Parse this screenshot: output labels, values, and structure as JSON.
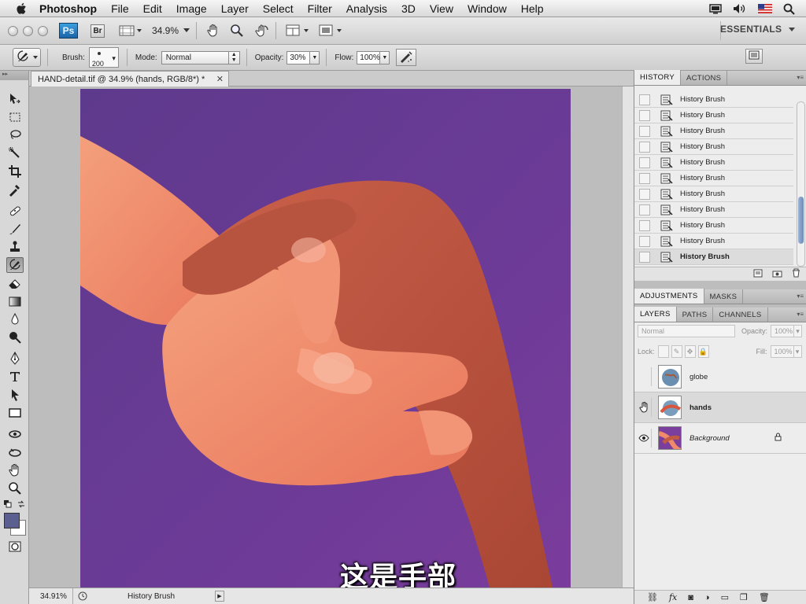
{
  "menubar": {
    "app_name": "Photoshop",
    "items": [
      "File",
      "Edit",
      "Image",
      "Layer",
      "Select",
      "Filter",
      "Analysis",
      "3D",
      "View",
      "Window",
      "Help"
    ]
  },
  "appbar": {
    "ps_label": "Ps",
    "br_label": "Br",
    "zoom": "34.9%",
    "workspace": "ESSENTIALS"
  },
  "options": {
    "brush_label": "Brush:",
    "brush_size": "200",
    "mode_label": "Mode:",
    "mode_value": "Normal",
    "opacity_label": "Opacity:",
    "opacity_value": "30%",
    "flow_label": "Flow:",
    "flow_value": "100%"
  },
  "document": {
    "tab_title": "HAND-detail.tif @ 34.9% (hands, RGB/8*) *",
    "subtitle": "这是手部",
    "status_zoom": "34.91%",
    "status_info": "History Brush"
  },
  "history_panel": {
    "tabs": [
      "HISTORY",
      "ACTIONS"
    ],
    "items": [
      "History Brush",
      "History Brush",
      "History Brush",
      "History Brush",
      "History Brush",
      "History Brush",
      "History Brush",
      "History Brush",
      "History Brush",
      "History Brush",
      "History Brush"
    ],
    "current_index": 10
  },
  "adjustments_panel": {
    "tabs": [
      "ADJUSTMENTS",
      "MASKS"
    ]
  },
  "layers_panel": {
    "tabs": [
      "LAYERS",
      "PATHS",
      "CHANNELS"
    ],
    "blend_mode": "Normal",
    "opacity_label": "Opacity:",
    "opacity_value": "100%",
    "lock_label": "Lock:",
    "fill_label": "Fill:",
    "fill_value": "100%",
    "layers": [
      {
        "name": "globe",
        "visible": false,
        "active": false,
        "locked": false
      },
      {
        "name": "hands",
        "visible": false,
        "active": true,
        "locked": false
      },
      {
        "name": "Background",
        "visible": true,
        "active": false,
        "locked": true
      }
    ]
  },
  "colors": {
    "canvas_purple": "#6b3a93",
    "foreground": "#5b5f8f",
    "background": "#ffffff",
    "skin": "#f08a6a"
  }
}
